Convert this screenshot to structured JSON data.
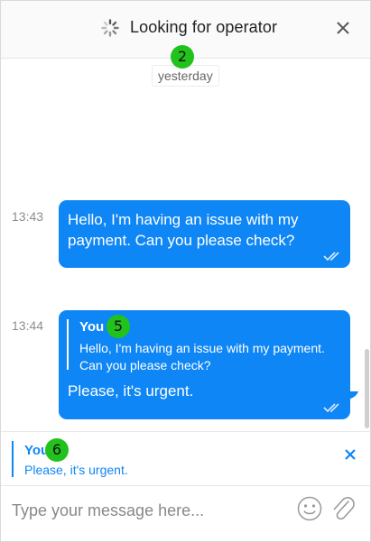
{
  "header": {
    "title": "Looking for operator",
    "date_chip": "yesterday"
  },
  "badges": {
    "a": "2",
    "b": "5",
    "c": "6"
  },
  "messages": [
    {
      "time": "13:43",
      "text": "Hello, I'm having an issue with my payment. Can you please check?"
    },
    {
      "time": "13:44",
      "quote_author": "You",
      "quote_text": "Hello, I'm having an issue with my payment. Can you please check?",
      "text": "Please, it's urgent."
    }
  ],
  "reply_preview": {
    "author": "You",
    "text": "Please, it's urgent."
  },
  "composer": {
    "placeholder": "Type your message here..."
  },
  "colors": {
    "accent": "#0f86f5",
    "badge": "#22c21d"
  },
  "icons": [
    "spinner-icon",
    "close-icon",
    "double-check-icon",
    "emoji-icon",
    "paperclip-icon"
  ]
}
